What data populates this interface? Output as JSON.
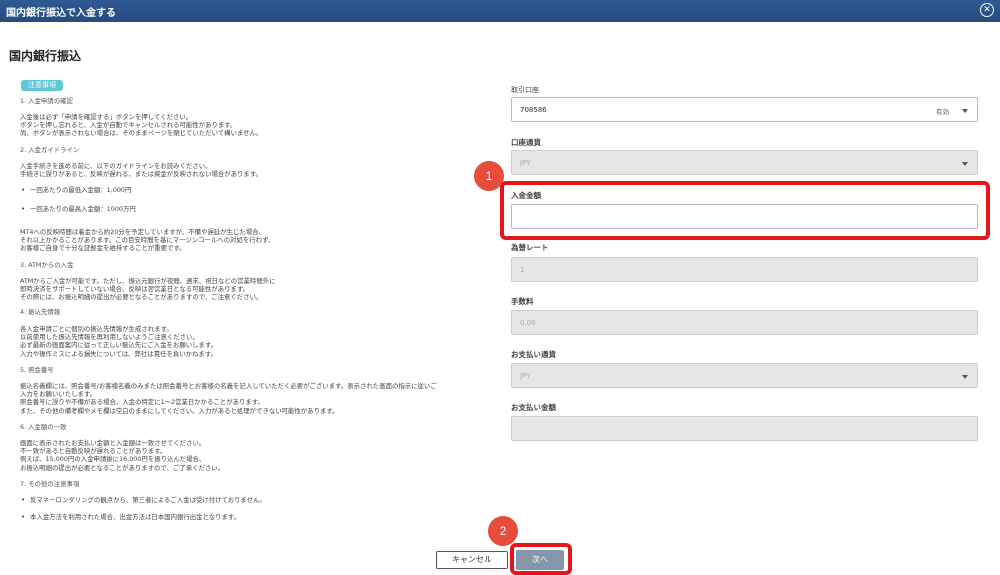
{
  "window": {
    "title": "国内銀行振込で入金する",
    "close_glyph": "✕"
  },
  "page_title": "国内銀行振込",
  "notice_badge": "注意事項",
  "notices": {
    "s1_title": "1. 入金申請の確認",
    "s1_l1": "入金後は必ず「申請を確認する」ボタンを押してください。",
    "s1_l2": "ボタンを押し忘れると、入金が自動でキャンセルされる可能性があります。",
    "s1_l3": "尚、ボタンが表示されない場合は、そのままページを閉じていただいて構いません。",
    "s2_title": "2. 入金ガイドライン",
    "s2_l1": "入金手続きを進める前に、以下のガイドラインをお読みください。",
    "s2_l2": "手続きに誤りがあると、反映が遅れる、または資金が反映されない場合があります。",
    "s2_b1": "一回あたりの最低入金額：1,000円",
    "s2_b2": "一回あたりの最高入金額：1000万円",
    "mt4_l1": "MT4への反映時間は着金から約20分を予定していますが、不備や遅延が生じた場合、",
    "mt4_l2": "それ以上かかることがあります。この目安時間を基にマージンコールへの対処を行わず、",
    "mt4_l3": "お客様ご自身で十分な証拠金を維持することが重要です。",
    "s3_title": "3. ATMからの入金",
    "s3_l1": "ATMからご入金が可能です。ただし、振込元銀行が夜間、週末、祝日などの営業時間外に",
    "s3_l2": "即時決済をサポートしていない場合、反映は翌営業日となる可能性があります。",
    "s3_l3": "その際には、お振込明細の提出が必要となることがありますので、ご注意ください。",
    "s4_title": "4. 振込先情報",
    "s4_l1": "各入金申請ごとに個別の振込先情報が生成されます。",
    "s4_l2": "以前使用した振込先情報を再利用しないようご注意ください。",
    "s4_l3": "必ず最新の画面案内に従って正しい振込先にご入金をお願いします。",
    "s4_l4": "入力や操作ミスによる損失については、弊社は責任を負いかねます。",
    "s5_title": "5. 照会番号",
    "s5_l1": "振込名義欄には、照会番号/お客様名義のみまたは照会番号とお客様の名義を記入していただく必要がございます。表示された画面の指示に従いご",
    "s5_l2": "入力をお願いいたします。",
    "s5_l3": "照会番号に誤りや不備がある場合、入金の特定に1～2営業日かかることがあります。",
    "s5_l4": "また、その他の備考欄やメモ欄は空白のままにしてください。入力があると処理ができない可能性があります。",
    "s6_title": "6. 入金額の一致",
    "s6_l1": "画面に表示されたお支払い金額と入金額は一致させてください。",
    "s6_l2": "不一致があると自動反映が遅れることがあります。",
    "s6_l3": "例えば、15,000円の入金申請後に16,000円を振り込んだ場合、",
    "s6_l4": "お振込明細の提出が必要となることがありますので、ご了承ください。",
    "s7_title": "7. その他の注意事項",
    "s7_b1": "反マネーロンダリングの観点から、第三者によるご入金は受け付けておりません。",
    "s7_b2": "本入金方法を利用された場合、出金方法は日本国内銀行出金となります。"
  },
  "form": {
    "account_label": "取引口座",
    "account_value": "708586",
    "account_status": "有効",
    "currency_label": "口座通貨",
    "currency_value": "JPY",
    "amount_label": "入金金額",
    "amount_value": "",
    "rate_label": "為替レート",
    "rate_value": "1",
    "fee_label": "手数料",
    "fee_value": "0.00",
    "pay_currency_label": "お支払い通貨",
    "pay_currency_value": "JPY",
    "pay_amount_label": "お支払い金額",
    "pay_amount_value": ""
  },
  "steps": {
    "one": "1",
    "two": "2"
  },
  "buttons": {
    "cancel": "キャンセル",
    "next": "次へ"
  },
  "colors": {
    "titlebar": "#2a5289",
    "accent_badge": "#61c7d5",
    "highlight": "#e3171b",
    "step_circle": "#e74c3c",
    "next_button": "#8696ad"
  }
}
